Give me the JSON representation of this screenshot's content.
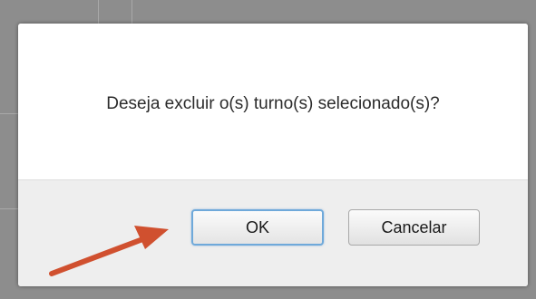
{
  "dialog": {
    "message": "Deseja excluir o(s) turno(s) selecionado(s)?",
    "ok_label": "OK",
    "cancel_label": "Cancelar"
  },
  "annotation": {
    "arrow_color": "#d0502f",
    "points_to": "ok-button"
  },
  "colors": {
    "backdrop": "#8d8d8d",
    "dialog_body": "#ffffff",
    "dialog_footer": "#eeeeee",
    "ok_focus_border": "#6fa9da"
  }
}
